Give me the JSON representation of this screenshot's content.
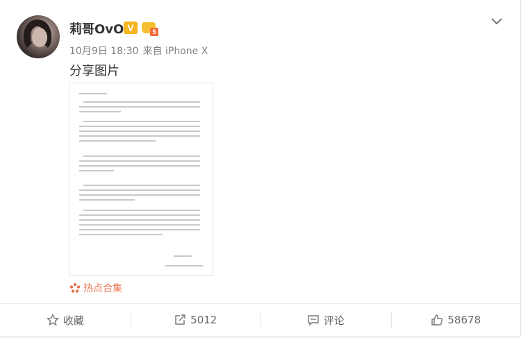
{
  "post": {
    "username": "莉哥OvO",
    "verified_badge": "V",
    "level_badge": "5",
    "date": "10月9日 18:30",
    "source": "来自 iPhone X",
    "text": "分享图片",
    "topic": "热点合集"
  },
  "actions": {
    "favorite_label": "收藏",
    "repost_count": "5012",
    "comment_label": "评论",
    "like_count": "58678"
  },
  "colors": {
    "topic": "#eb7350",
    "badge_v": "#f4b51e",
    "meta": "#808080"
  },
  "icons": {
    "more": "chevron-down-icon",
    "topic": "hot-topic-icon",
    "favorite": "star-icon",
    "repost": "repost-icon",
    "comment": "comment-icon",
    "like": "thumbs-up-icon"
  }
}
